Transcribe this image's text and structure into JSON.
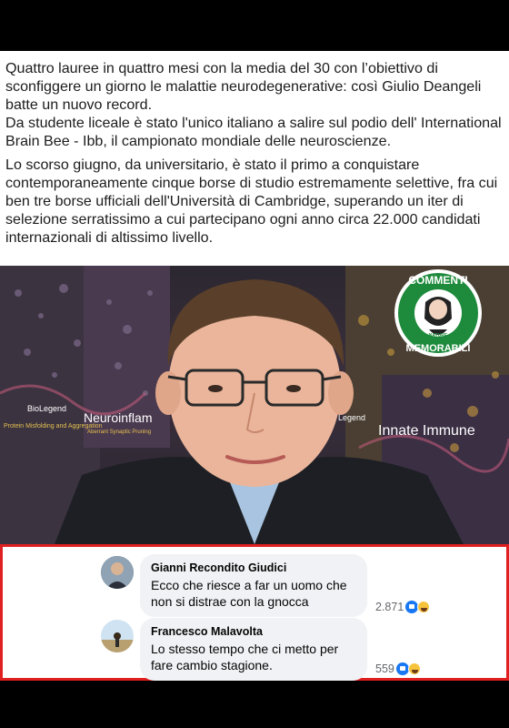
{
  "post": {
    "paragraph1": "Quattro lauree in quattro mesi con la media del 30 con l’obiettivo di sconfiggere un giorno le malattie neurodegenerative: così Giulio Deangeli batte un nuovo record.\nDa studente liceale è stato l'unico italiano a salire sul podio dell' International Brain Bee - Ibb, il campionato mondiale delle neuroscienze.",
    "paragraph2": "Lo scorso giugno, da universitario, è stato il primo a conquistare contemporaneamente cinque borse di studio estremamente selettive, fra cui ben tre borse ufficiali dell'Università di Cambridge, superando un iter di selezione serratissimo a cui partecipano ogni anno circa 22.000 candidati internazionali di altissimo livello."
  },
  "photo": {
    "poster_labels": [
      "BioLegend",
      "Neuroinflam",
      "Legend",
      "Innate Immune"
    ],
    "poster_small_labels": [
      "Protein Misfolding and Aggregation",
      "Aberrant Synaptic Pruning"
    ]
  },
  "badge": {
    "top": "COMMENTI",
    "bottom": "MEMORABILI",
    "tm": "TM",
    "small1": "NATURE",
    "small2": "FIRE"
  },
  "comments": [
    {
      "author": "Gianni Recondito Giudici",
      "text": "Ecco che riesce a far un uomo che\nnon si distrae con la gnocca",
      "reactions": "2.871"
    },
    {
      "author": "Francesco Malavolta",
      "text": "Lo stesso tempo che ci metto per\nfare cambio stagione.",
      "reactions": "559"
    }
  ],
  "colors": {
    "frame_border": "#e02020",
    "badge_green": "#1e8a3c",
    "like_blue": "#1877f2"
  }
}
